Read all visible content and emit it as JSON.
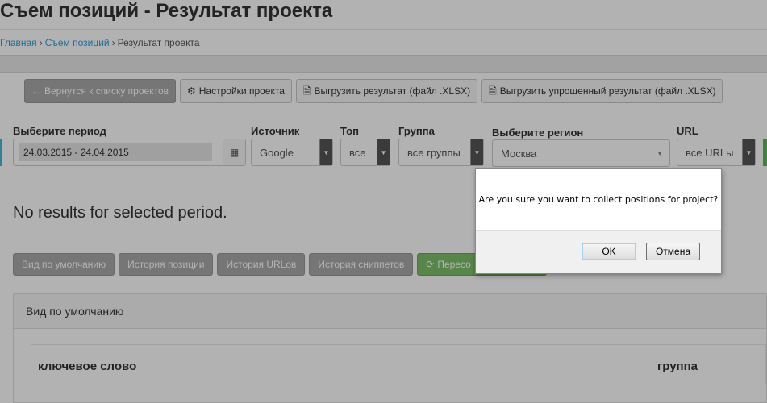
{
  "page": {
    "title": "Съем позиций - Результат проекта"
  },
  "breadcrumb": {
    "home": "Главная",
    "section": "Съем позиций",
    "current": "Результат проекта",
    "separator": "›"
  },
  "toolbar": {
    "back": "Вернутся к списку проектов",
    "settings": "Настройки проекта",
    "export_xlsx": "Выгрузить результат (файл .XLSX)",
    "export_simple_xlsx": "Выгрузить упрощенный результат (файл .XLSX)"
  },
  "filters": {
    "period": {
      "label": "Выберите период",
      "value": "24.03.2015 - 24.04.2015"
    },
    "source": {
      "label": "Источник",
      "value": "Google"
    },
    "top": {
      "label": "Топ",
      "value": "все"
    },
    "group": {
      "label": "Группа",
      "value": "все группы"
    },
    "region": {
      "label": "Выберите регион",
      "value": "Москва"
    },
    "url": {
      "label": "URL",
      "value": "все URLы"
    }
  },
  "results": {
    "message": "No results for selected period."
  },
  "views": {
    "default": "Вид по умолчанию",
    "position_history": "История позиции",
    "url_history": "История URLов",
    "snippet_history": "История сниппетов",
    "recollect": "Пересо"
  },
  "panel": {
    "title": "Вид по умолчанию",
    "columns": [
      "ключевое слово",
      "группа"
    ]
  },
  "dialog": {
    "message": "Are you sure you want to collect positions for project?",
    "ok": "OK",
    "cancel": "Отмена"
  },
  "colors": {
    "link": "#2a9fd6",
    "overlay": "rgba(0,0,0,0.30)",
    "button_default": "#a9a9a9",
    "button_success": "#7fbf6a"
  }
}
